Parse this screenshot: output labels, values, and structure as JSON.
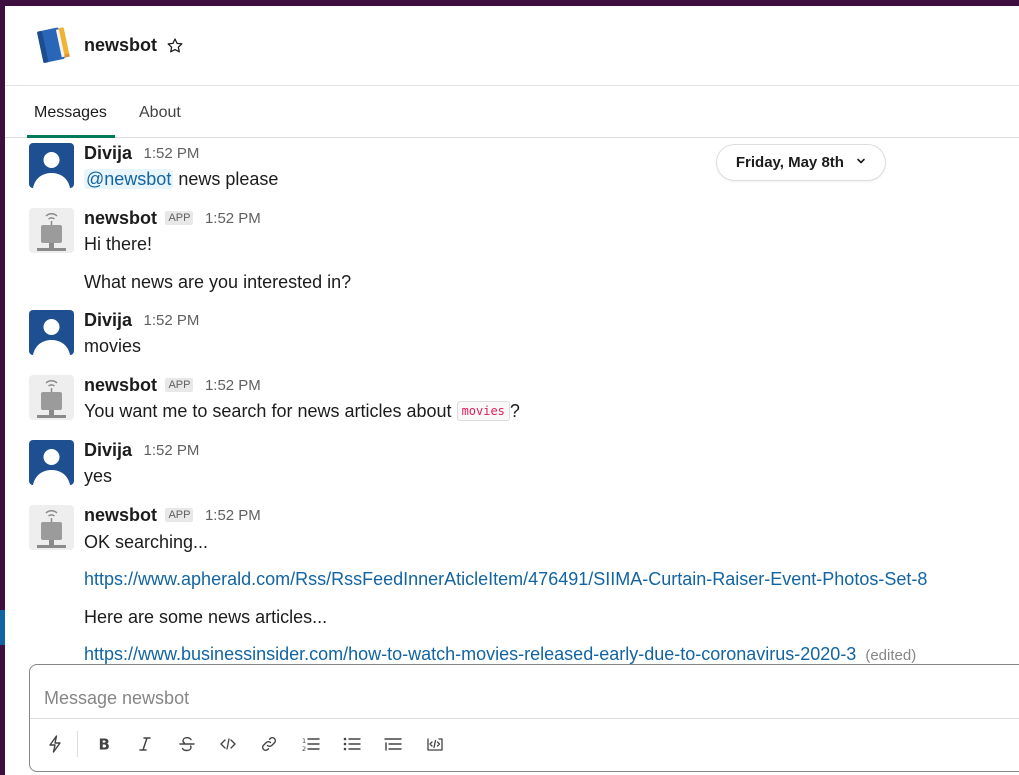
{
  "channel": {
    "name": "newsbot",
    "icon": "notebook-icon"
  },
  "tabs": [
    {
      "label": "Messages",
      "active": true
    },
    {
      "label": "About",
      "active": false
    }
  ],
  "date_divider": "Friday, May 8th",
  "messages": [
    {
      "sender": "Divija",
      "time": "1:52 PM",
      "mention": "@newsbot",
      "text": "news please"
    },
    {
      "sender": "newsbot",
      "badge": "APP",
      "time": "1:52 PM",
      "lines": [
        "Hi there!",
        "What news are you interested in?"
      ]
    },
    {
      "sender": "Divija",
      "time": "1:52 PM",
      "text": "movies"
    },
    {
      "sender": "newsbot",
      "badge": "APP",
      "time": "1:52 PM",
      "text_before": "You want me to search for news articles about",
      "code": "movies",
      "text_after": "?"
    },
    {
      "sender": "Divija",
      "time": "1:52 PM",
      "text": "yes"
    },
    {
      "sender": "newsbot",
      "badge": "APP",
      "time": "1:52 PM",
      "line1": "OK searching...",
      "link1": "https://www.apherald.com/Rss/RssFeedInnerAticleItem/476491/SIIMA-Curtain-Raiser-Event-Photos-Set-8",
      "line3": "Here are some news articles...",
      "link2": "https://www.businessinsider.com/how-to-watch-movies-released-early-due-to-coronavirus-2020-3",
      "edited": "(edited)"
    }
  ],
  "composer": {
    "placeholder": "Message newsbot",
    "tools": [
      "shortcuts-icon",
      "bold-icon",
      "italic-icon",
      "strikethrough-icon",
      "code-icon",
      "link-icon",
      "ordered-list-icon",
      "bulleted-list-icon",
      "blockquote-icon",
      "code-block-icon"
    ]
  },
  "colors": {
    "sidebar": "#3f0e40",
    "accent": "#007a5a",
    "link": "#1264a3",
    "code": "#e01e5a"
  }
}
